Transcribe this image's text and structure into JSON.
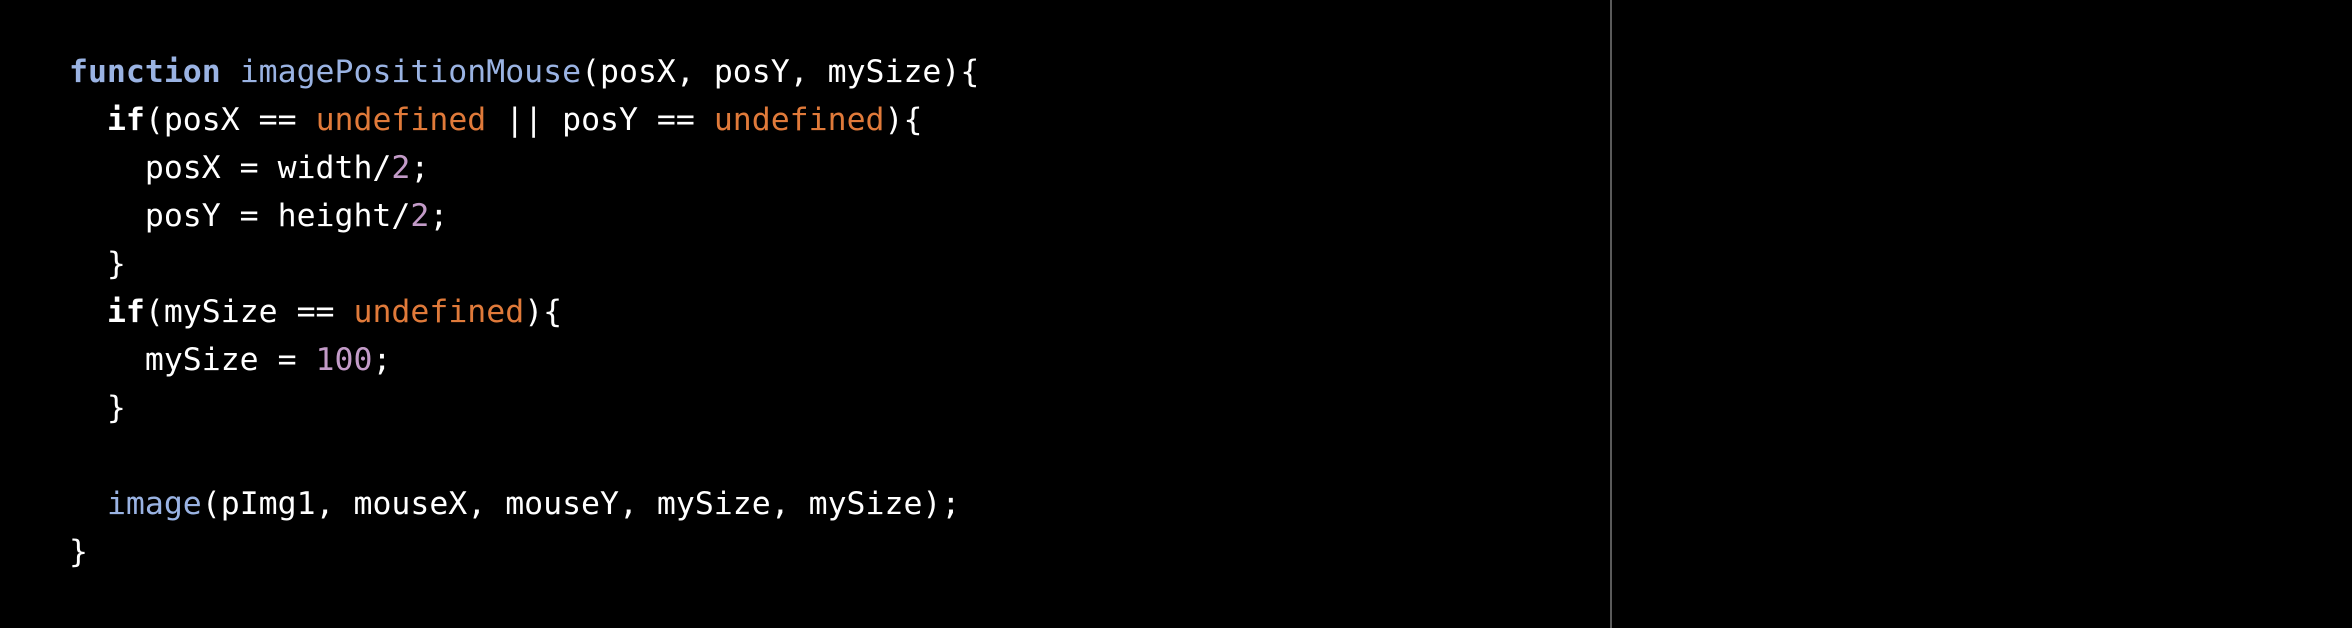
{
  "colors": {
    "background": "#000000",
    "keyword": "#ffffff",
    "function_keyword": "#9ab3e3",
    "function_name": "#9ab3e3",
    "undefined_literal": "#e07a3a",
    "number_literal": "#c39bc8",
    "text": "#ffffff",
    "divider": "#5a5a5a"
  },
  "code": {
    "lines": [
      [
        {
          "t": "kw-fn",
          "v": "function"
        },
        {
          "t": "plain",
          "v": " "
        },
        {
          "t": "fn",
          "v": "imagePositionMouse"
        },
        {
          "t": "plain",
          "v": "(posX, posY, mySize){"
        }
      ],
      [
        {
          "t": "plain",
          "v": "  "
        },
        {
          "t": "kw",
          "v": "if"
        },
        {
          "t": "plain",
          "v": "(posX == "
        },
        {
          "t": "undef",
          "v": "undefined"
        },
        {
          "t": "plain",
          "v": " || posY == "
        },
        {
          "t": "undef",
          "v": "undefined"
        },
        {
          "t": "plain",
          "v": "){"
        }
      ],
      [
        {
          "t": "plain",
          "v": "    posX = width/"
        },
        {
          "t": "num",
          "v": "2"
        },
        {
          "t": "plain",
          "v": ";"
        }
      ],
      [
        {
          "t": "plain",
          "v": "    posY = height/"
        },
        {
          "t": "num",
          "v": "2"
        },
        {
          "t": "plain",
          "v": ";"
        }
      ],
      [
        {
          "t": "plain",
          "v": "  }"
        }
      ],
      [
        {
          "t": "plain",
          "v": "  "
        },
        {
          "t": "kw",
          "v": "if"
        },
        {
          "t": "plain",
          "v": "(mySize == "
        },
        {
          "t": "undef",
          "v": "undefined"
        },
        {
          "t": "plain",
          "v": "){"
        }
      ],
      [
        {
          "t": "plain",
          "v": "    mySize = "
        },
        {
          "t": "num",
          "v": "100"
        },
        {
          "t": "plain",
          "v": ";"
        }
      ],
      [
        {
          "t": "plain",
          "v": "  }"
        }
      ],
      [
        {
          "t": "plain",
          "v": ""
        }
      ],
      [
        {
          "t": "plain",
          "v": "  "
        },
        {
          "t": "fn",
          "v": "image"
        },
        {
          "t": "plain",
          "v": "(pImg1, mouseX, mouseY, mySize, mySize);"
        }
      ],
      [
        {
          "t": "plain",
          "v": "}"
        }
      ]
    ]
  }
}
